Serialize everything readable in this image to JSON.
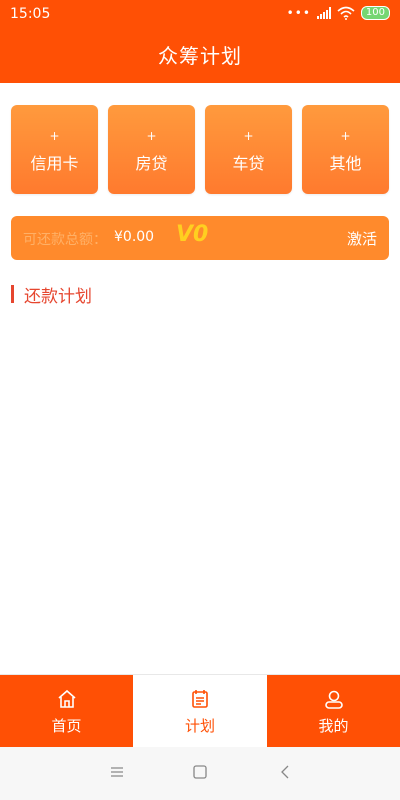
{
  "status": {
    "time": "15:05",
    "battery": "100"
  },
  "header": {
    "title": "众筹计划"
  },
  "cards": [
    {
      "plus": "+",
      "label": "信用卡"
    },
    {
      "plus": "+",
      "label": "房贷"
    },
    {
      "plus": "+",
      "label": "车贷"
    },
    {
      "plus": "+",
      "label": "其他"
    }
  ],
  "total": {
    "label": "可还款总额：",
    "amount": "¥0.00",
    "vip": "V0",
    "activate": "激活"
  },
  "section": {
    "title": "还款计划"
  },
  "tabs": [
    {
      "label": "首页",
      "icon": "home-icon"
    },
    {
      "label": "计划",
      "icon": "plan-icon"
    },
    {
      "label": "我的",
      "icon": "user-icon"
    }
  ],
  "colors": {
    "primary": "#ff5005",
    "card": "#ff8a2c",
    "accent": "#e6462f",
    "vip": "#ffcf20"
  }
}
